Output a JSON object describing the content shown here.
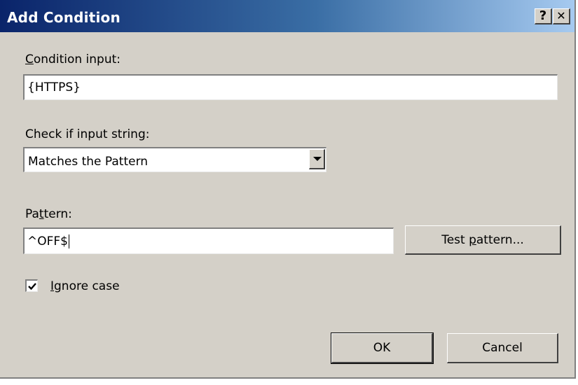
{
  "window": {
    "title": "Add Condition",
    "help_label": "?",
    "close_label": "✕",
    "help_icon": "question-mark",
    "close_icon": "x-mark"
  },
  "condition_input": {
    "label_prefix": "",
    "label_accel": "C",
    "label_rest": "ondition input:",
    "value": "{HTTPS}"
  },
  "check_input": {
    "label": "Check if input string:",
    "selected": "Matches the Pattern"
  },
  "pattern": {
    "label_prefix": "Pa",
    "label_accel": "t",
    "label_rest": "tern:",
    "value": "^OFF$"
  },
  "test_pattern_button": {
    "label_prefix": "Test ",
    "label_accel": "p",
    "label_rest": "attern..."
  },
  "ignore_case": {
    "checked": true,
    "label_prefix": "",
    "label_accel": "I",
    "label_rest": "gnore case"
  },
  "buttons": {
    "ok": "OK",
    "cancel": "Cancel"
  },
  "colors": {
    "dialog_bg": "#d4d0c8",
    "title_start": "#0a246a",
    "title_end": "#a6caf0"
  }
}
